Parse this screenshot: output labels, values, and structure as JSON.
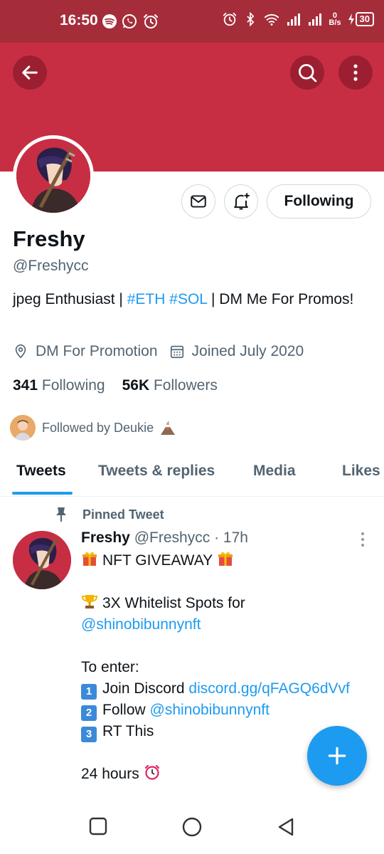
{
  "status_bar": {
    "time": "16:50",
    "network_speed_value": "0",
    "network_speed_unit": "B/s",
    "battery": "30",
    "left_icons": [
      "spotify-icon",
      "whatsapp-icon",
      "alarm-icon"
    ],
    "right_icons": [
      "alarm-icon",
      "bluetooth-icon",
      "wifi-icon",
      "signal-icon",
      "signal-icon",
      "battery-charging-icon"
    ]
  },
  "header": {
    "banner_color": "#c72e44",
    "back_icon": "arrow-left-icon",
    "search_icon": "search-icon",
    "more_icon": "more-vertical-icon"
  },
  "profile": {
    "name": "Freshy",
    "handle": "@Freshycc",
    "bio_prefix": "jpeg Enthusiast | ",
    "bio_tag1": "#ETH",
    "bio_tag2": "#SOL",
    "bio_suffix": " | DM Me For Promos!",
    "location": "DM For Promotion",
    "joined": "Joined July 2020",
    "following_count": "341",
    "following_label": "Following",
    "followers_count": "56K",
    "followers_label": "Followers",
    "followed_by": "Followed by Deukie",
    "follow_button": "Following"
  },
  "tabs": [
    {
      "label": "Tweets",
      "active": true
    },
    {
      "label": "Tweets & replies",
      "active": false
    },
    {
      "label": "Media",
      "active": false
    },
    {
      "label": "Likes",
      "active": false
    }
  ],
  "tweet": {
    "pinned_label": "Pinned Tweet",
    "author": "Freshy",
    "handle": "@Freshycc",
    "time": "· 17h",
    "line1": "NFT GIVEAWAY",
    "line2": "3X Whitelist Spots for",
    "mention": "@shinobibunnynft",
    "to_enter": "To enter:",
    "step1_num": "1",
    "step1": "Join Discord ",
    "step1_link": "discord.gg/qFAGQ6dVvf",
    "step2_num": "2",
    "step2": "Follow ",
    "step2_link": "@shinobibunnynft",
    "step3_num": "3",
    "step3": "RT This",
    "duration": "24 hours"
  },
  "colors": {
    "accent": "#1d9bf0",
    "status_bar": "#a52d3a",
    "banner": "#c72e44"
  }
}
